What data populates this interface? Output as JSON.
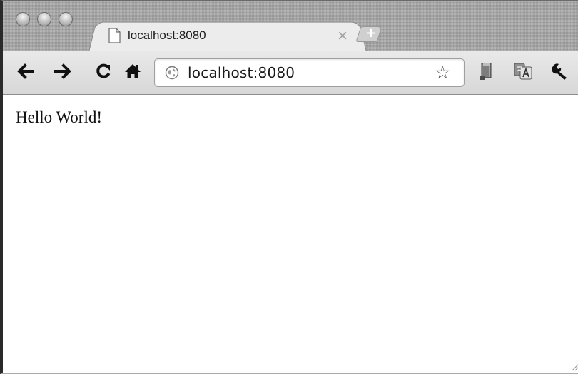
{
  "window": {
    "tab": {
      "title": "localhost:8080",
      "close_glyph": "×",
      "icon": "document-icon"
    },
    "new_tab_glyph": "+",
    "traffic_lights": [
      "close",
      "minimize",
      "zoom"
    ]
  },
  "toolbar": {
    "back_icon": "arrow-left-icon",
    "forward_icon": "arrow-right-icon",
    "reload_icon": "reload-icon",
    "home_icon": "home-icon",
    "address": {
      "value": "localhost:8080",
      "site_icon": "globe-icon"
    },
    "star_glyph": "☆",
    "extensions": [
      "bookmark-extension-icon",
      "translate-icon",
      "wrench-icon"
    ]
  },
  "page": {
    "content": "Hello World!"
  }
}
